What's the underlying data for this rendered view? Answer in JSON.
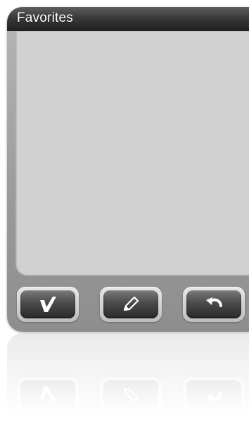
{
  "window": {
    "title": "Favorites"
  },
  "favorites": {
    "items": []
  },
  "toolbar": {
    "buttons": [
      {
        "id": "accept",
        "icon": "checkmark-icon"
      },
      {
        "id": "edit",
        "icon": "pencil-icon"
      },
      {
        "id": "back",
        "icon": "undo-arrow-icon"
      }
    ]
  },
  "colors": {
    "title_bar": "#2e2e2e",
    "title_text": "#ffffff",
    "content_bg": "#d1d1d1",
    "button_face": "#3a3a3a",
    "button_icon": "#ffffff"
  }
}
